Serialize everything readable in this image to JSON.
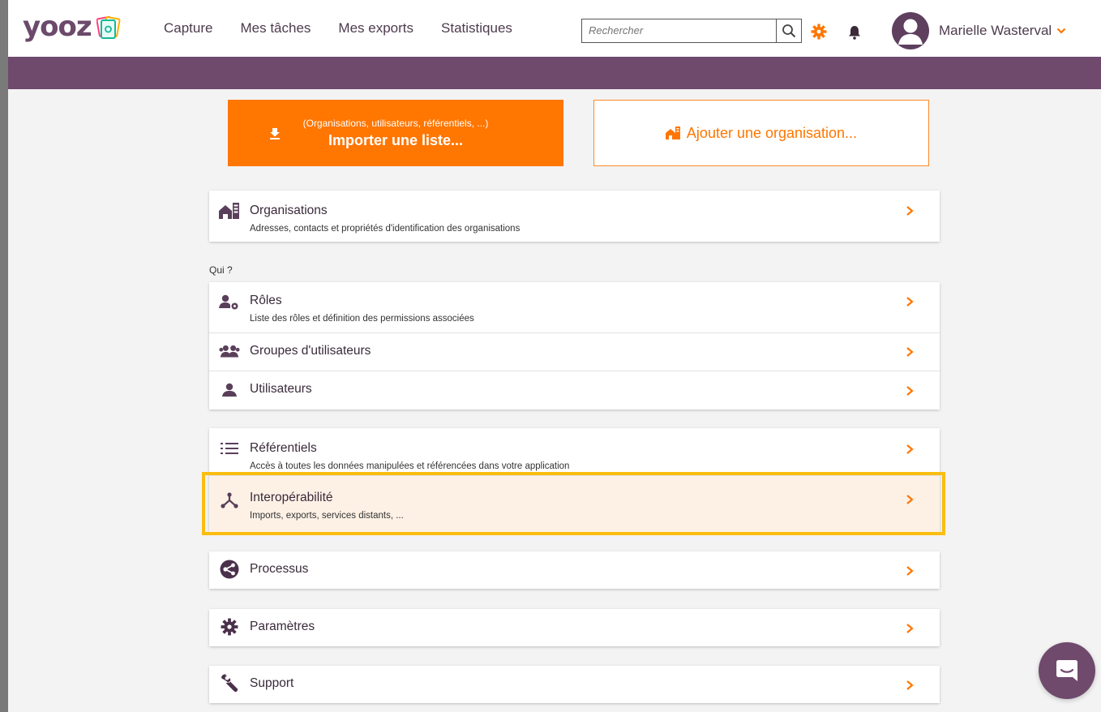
{
  "app": {
    "logo_text": "yooz"
  },
  "nav": {
    "items": [
      {
        "label": "Capture"
      },
      {
        "label": "Mes tâches"
      },
      {
        "label": "Mes exports"
      },
      {
        "label": "Statistiques"
      }
    ]
  },
  "search": {
    "placeholder": "Rechercher",
    "value": ""
  },
  "user": {
    "name": "Marielle Wasterval"
  },
  "actions": {
    "import_sub": "(Organisations, utilisateurs, référentiels, ...)",
    "import_label": "Importer une liste...",
    "add_org_label": "Ajouter une organisation..."
  },
  "sections": {
    "qui_label": "Qui ?"
  },
  "menu": {
    "organisations": {
      "title": "Organisations",
      "desc": "Adresses, contacts et propriétés d'identification des organisations",
      "icon": "building-icon"
    },
    "roles": {
      "title": "Rôles",
      "desc": "Liste des rôles et définition des permissions associées",
      "icon": "user-gear-icon"
    },
    "groupes": {
      "title": "Groupes d'utilisateurs",
      "icon": "users-group-icon"
    },
    "utilisateurs": {
      "title": "Utilisateurs",
      "icon": "user-icon"
    },
    "referentiels": {
      "title": "Référentiels",
      "desc": "Accès à toutes les données manipulées et référencées dans votre application",
      "icon": "list-icon"
    },
    "interop": {
      "title": "Interopérabilité",
      "desc": "Imports, exports, services distants, ...",
      "icon": "network-icon"
    },
    "processus": {
      "title": "Processus",
      "icon": "share-icon"
    },
    "parametres": {
      "title": "Paramètres",
      "icon": "gear-icon"
    },
    "support": {
      "title": "Support",
      "icon": "wrench-icon"
    }
  },
  "colors": {
    "accent_orange": "#ff7600",
    "brand_purple": "#6f4a6d",
    "highlight": "#fbbd10",
    "selected_row": "#fdf1e6"
  }
}
